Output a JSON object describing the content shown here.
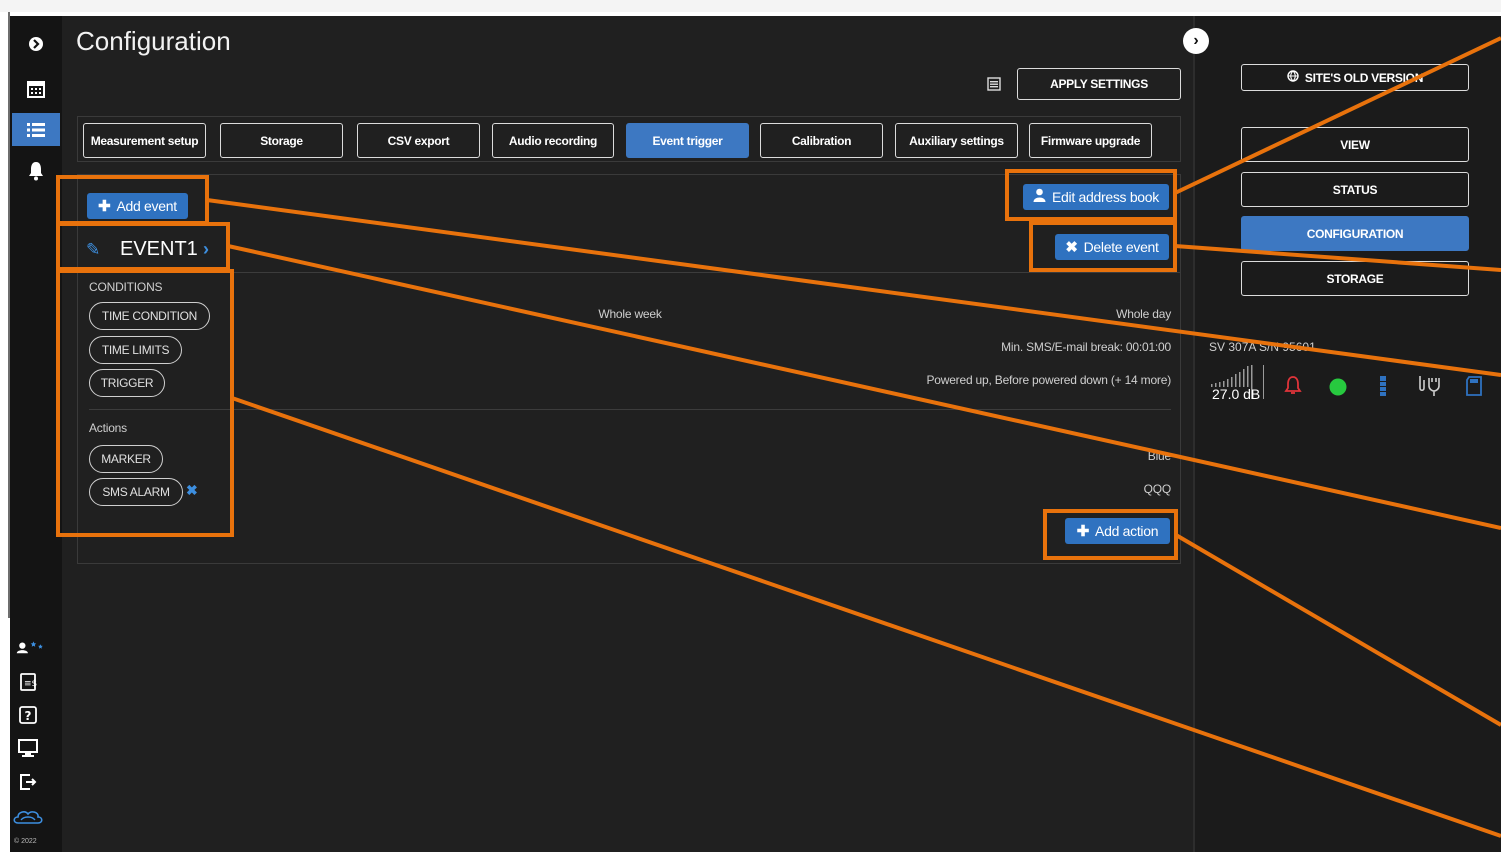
{
  "page": {
    "title": "Configuration"
  },
  "sidebar": {
    "icons": [
      "collapse-icon",
      "calendar-icon",
      "list-icon",
      "bell-icon",
      "user-star-icon",
      "export-icon",
      "help-icon",
      "monitor-icon",
      "logout-icon",
      "cloud-icon"
    ],
    "copyright": "© 2022"
  },
  "toolbar": {
    "apply_settings": "APPLY SETTINGS"
  },
  "tabs": [
    {
      "label": "Measurement setup",
      "active": false
    },
    {
      "label": "Storage",
      "active": false
    },
    {
      "label": "CSV export",
      "active": false
    },
    {
      "label": "Audio recording",
      "active": false
    },
    {
      "label": "Event trigger",
      "active": true
    },
    {
      "label": "Calibration",
      "active": false
    },
    {
      "label": "Auxiliary settings",
      "active": false
    },
    {
      "label": "Firmware upgrade",
      "active": false
    }
  ],
  "event": {
    "add_event": "Add event",
    "edit_address_book": "Edit address book",
    "delete_event": "Delete event",
    "name": "EVENT1",
    "conditions_label": "CONDITIONS",
    "conditions": [
      "TIME CONDITION",
      "TIME LIMITS",
      "TRIGGER"
    ],
    "condition_values": {
      "week": "Whole week",
      "day": "Whole day",
      "limits": "Min. SMS/E-mail break: 00:01:00",
      "trigger": "Powered up, Before powered down (+ 14 more)"
    },
    "actions_label": "Actions",
    "actions": [
      "MARKER",
      "SMS ALARM"
    ],
    "action_values": {
      "marker": "Blue",
      "sms": "QQQ"
    },
    "add_action": "Add action"
  },
  "right_panel": {
    "old_version": "SITE'S OLD VERSION",
    "nav": [
      {
        "label": "VIEW",
        "active": false
      },
      {
        "label": "STATUS",
        "active": false
      },
      {
        "label": "CONFIGURATION",
        "active": true
      },
      {
        "label": "STORAGE",
        "active": false
      }
    ],
    "serial": "SV 307A S/N 95601",
    "signal": "27.0 dB"
  },
  "colors": {
    "accent": "#3d78c2",
    "annotation": "#e8720c",
    "background": "#202020",
    "status_green": "#27c93f",
    "alarm_red": "#e0343a"
  }
}
